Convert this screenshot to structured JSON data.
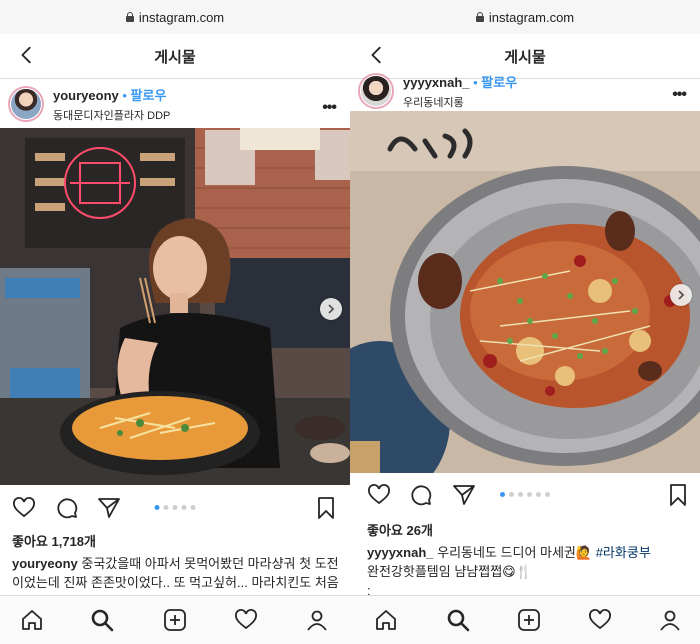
{
  "browser": {
    "url": "instagram.com"
  },
  "header": {
    "title": "게시물"
  },
  "left_post": {
    "username": "youryeony",
    "separator": " • ",
    "follow_label": "팔로우",
    "location": "동대문디자인플라자 DDP",
    "likes": "좋아요 1,718개",
    "caption_user": "youryeony",
    "caption_text": " 중국갔을때 아파서 못먹어봤던 마라샹궈 첫 도전이었는데 진짜 존존맛이었다.. 또 먹고싶허... 마라치킨도 처음",
    "carousel": {
      "count": 5,
      "active": 1
    }
  },
  "right_post": {
    "username": "yyyyxnah_",
    "separator": " • ",
    "follow_label": "팔로우",
    "location": "우리동네지롱",
    "likes": "좋아요 26개",
    "caption_user": "yyyyxnah_",
    "caption_text": " 우리동네도 드디어 마세권🙋 ",
    "hashtag": "#라화쿵부",
    "caption_text2": "완전강핫플템임 냠냠쩝쩝😋🍴",
    "caption_more": ":",
    "carousel": {
      "count": 6,
      "active": 1
    }
  },
  "icons": {
    "nav": [
      "home-icon",
      "search-icon",
      "add-post-icon",
      "activity-heart-icon",
      "profile-icon"
    ],
    "actions": [
      "like-heart-icon",
      "comment-icon",
      "share-icon",
      "save-bookmark-icon"
    ]
  },
  "colors": {
    "accent": "#3897f0",
    "hashtag": "#003569",
    "text": "#262626",
    "border": "#dbdbdb"
  }
}
